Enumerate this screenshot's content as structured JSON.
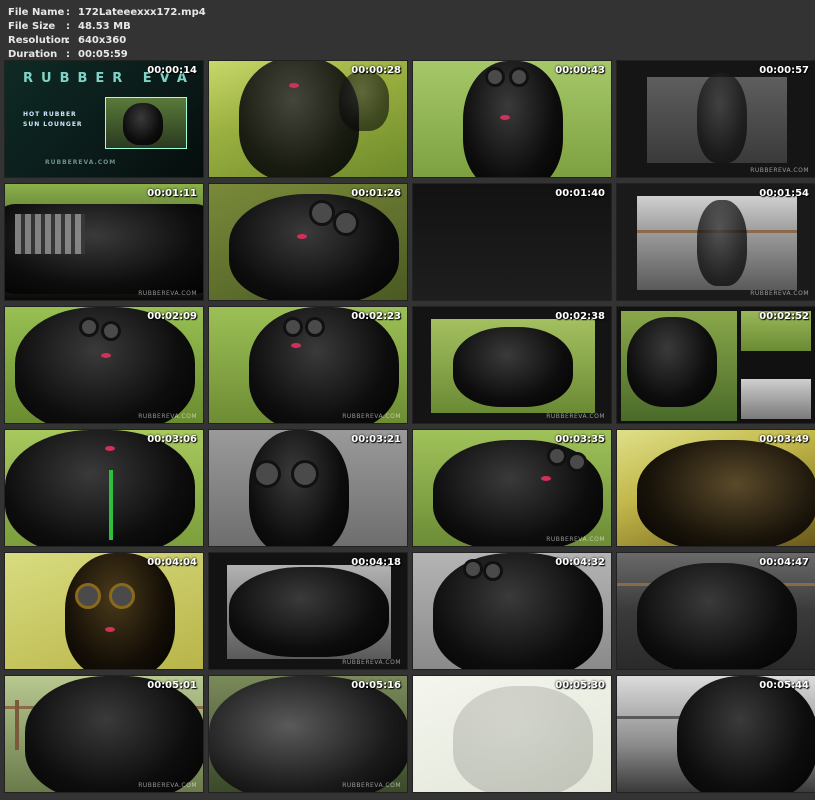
{
  "info": {
    "rows": [
      {
        "label": "File Name",
        "value": "172Lateeexxx172.mp4"
      },
      {
        "label": "File Size",
        "value": "48.53 MB"
      },
      {
        "label": "Resolution",
        "value": "640x360"
      },
      {
        "label": "Duration",
        "value": "00:05:59"
      }
    ],
    "separator": ":"
  },
  "thumbnails": [
    {
      "time": "00:00:14"
    },
    {
      "time": "00:00:28"
    },
    {
      "time": "00:00:43"
    },
    {
      "time": "00:00:57"
    },
    {
      "time": "00:01:11"
    },
    {
      "time": "00:01:26"
    },
    {
      "time": "00:01:40"
    },
    {
      "time": "00:01:54"
    },
    {
      "time": "00:02:09"
    },
    {
      "time": "00:02:23"
    },
    {
      "time": "00:02:38"
    },
    {
      "time": "00:02:52"
    },
    {
      "time": "00:03:06"
    },
    {
      "time": "00:03:21"
    },
    {
      "time": "00:03:35"
    },
    {
      "time": "00:03:49"
    },
    {
      "time": "00:04:04"
    },
    {
      "time": "00:04:18"
    },
    {
      "time": "00:04:32"
    },
    {
      "time": "00:04:47"
    },
    {
      "time": "00:05:01"
    },
    {
      "time": "00:05:16"
    },
    {
      "time": "00:05:30"
    },
    {
      "time": "00:05:44"
    }
  ],
  "logo": {
    "title": "RUBBER EVA",
    "line1": "HOT RUBBER",
    "line2": "SUN LOUNGER",
    "url": "RUBBEREVA.COM"
  },
  "watermark": "RUBBEREVA.COM",
  "colors": {
    "background": "#333333",
    "hose": "#2fbf3a",
    "grass": "#7fae3c",
    "lips": "#d0305a"
  }
}
